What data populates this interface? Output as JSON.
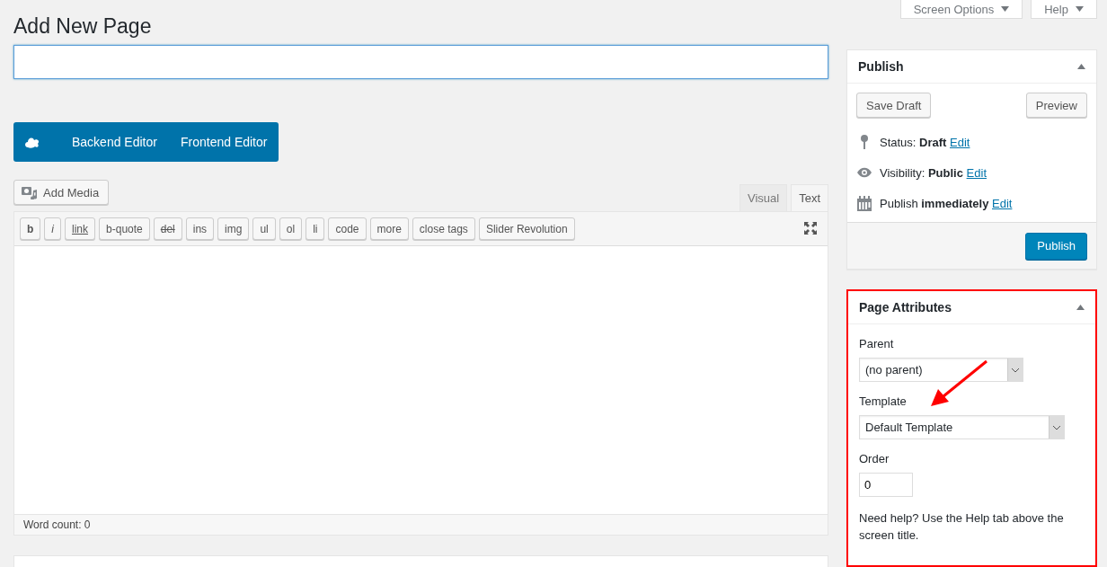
{
  "screen_meta": {
    "buttons": [
      {
        "label": "Screen Options"
      },
      {
        "label": "Help"
      }
    ]
  },
  "heading": "Add New Page",
  "composer": {
    "buttons": [
      "Backend Editor",
      "Frontend Editor"
    ]
  },
  "editor": {
    "add_media": "Add Media",
    "tabs": [
      {
        "label": "Visual",
        "selected": false
      },
      {
        "label": "Text",
        "selected": true
      }
    ],
    "quicktags": [
      {
        "label": "b",
        "kind": "bold"
      },
      {
        "label": "i",
        "kind": "italic"
      },
      {
        "label": "link",
        "kind": "underline"
      },
      {
        "label": "b-quote",
        "kind": "plain"
      },
      {
        "label": "del",
        "kind": "strike"
      },
      {
        "label": "ins",
        "kind": "plain"
      },
      {
        "label": "img",
        "kind": "plain"
      },
      {
        "label": "ul",
        "kind": "plain"
      },
      {
        "label": "ol",
        "kind": "plain"
      },
      {
        "label": "li",
        "kind": "plain"
      },
      {
        "label": "code",
        "kind": "plain"
      },
      {
        "label": "more",
        "kind": "plain"
      },
      {
        "label": "close tags",
        "kind": "plain"
      },
      {
        "label": "Slider Revolution",
        "kind": "plain"
      }
    ],
    "word_count": "Word count: 0"
  },
  "publish": {
    "title": "Publish",
    "save_draft": "Save Draft",
    "preview": "Preview",
    "rows": [
      {
        "kind": "status",
        "text": "Status: **Draft**",
        "link": "Edit"
      },
      {
        "kind": "visibility",
        "text": "Visibility: **Public**",
        "link": "Edit"
      },
      {
        "kind": "schedule",
        "text": "Publish **immediately**",
        "link": "Edit"
      }
    ],
    "button": "Publish"
  },
  "page_attributes": {
    "title": "Page Attributes",
    "highlighted": true,
    "parent_label": "Parent",
    "parent_value": "(no parent)",
    "template_label": "Template",
    "template_value": "Default Template",
    "order_label": "Order",
    "order_value": "0",
    "help": "Need help? Use the Help tab above the screen title."
  }
}
